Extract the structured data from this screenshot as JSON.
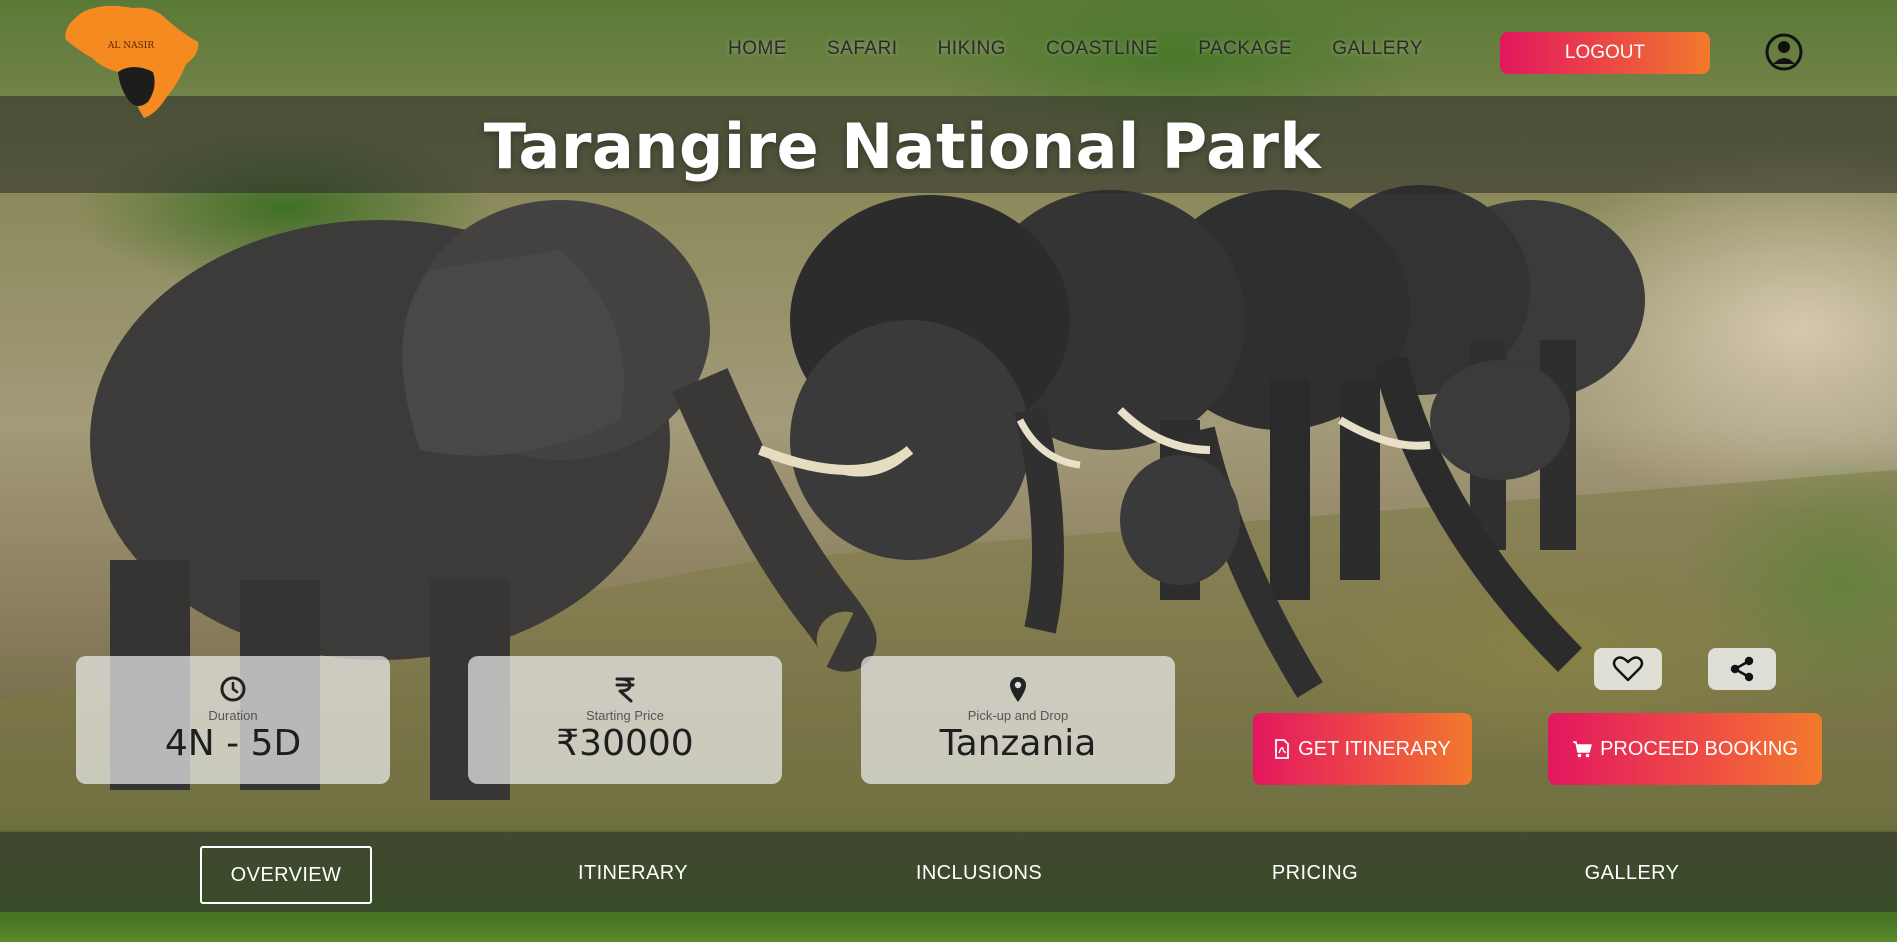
{
  "brand": {
    "logo_icon": "africa-map-logo-icon",
    "logo_text": "AL NASIR"
  },
  "nav": {
    "links": [
      "HOME",
      "SAFARI",
      "HIKING",
      "COASTLINE",
      "PACKAGE",
      "GALLERY"
    ],
    "logout_label": "LOGOUT",
    "user_icon": "user-circle-icon"
  },
  "hero": {
    "title": "Tarangire National Park"
  },
  "cards": [
    {
      "icon": "clock-icon",
      "label": "Duration",
      "value": "4N - 5D"
    },
    {
      "icon": "rupee-icon",
      "label": "Starting Price",
      "value": "₹30000"
    },
    {
      "icon": "map-pin-icon",
      "label": "Pick-up and Drop",
      "value": "Tanzania"
    }
  ],
  "actions": {
    "favorite_icon": "heart-icon",
    "share_icon": "share-icon",
    "get_itinerary_label": "GET ITINERARY",
    "proceed_booking_label": "PROCEED BOOKING"
  },
  "tabs": [
    {
      "label": "OVERVIEW",
      "active": true
    },
    {
      "label": "ITINERARY",
      "active": false
    },
    {
      "label": "INCLUSIONS",
      "active": false
    },
    {
      "label": "PRICING",
      "active": false
    },
    {
      "label": "GALLERY",
      "active": false
    }
  ],
  "colors": {
    "accent_start": "#e3175f",
    "accent_end": "#f27a2c",
    "overlay": "rgba(40,40,40,0.55)"
  }
}
